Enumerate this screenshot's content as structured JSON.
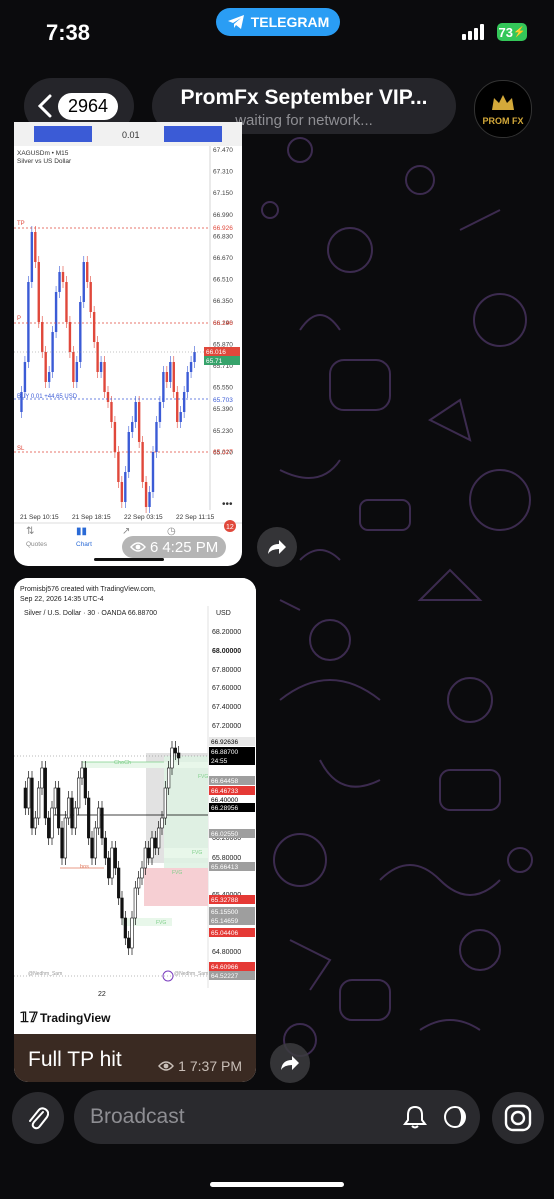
{
  "status_bar": {
    "time": "7:38",
    "telegram_label": "TELEGRAM",
    "battery": "73"
  },
  "header": {
    "back_count": "2964",
    "title": "PromFx September VIP...",
    "subtitle": "waiting for network...",
    "avatar_text": "PROM FX"
  },
  "message1": {
    "symbol": "XAGUSDm • M15",
    "description": "Silver vs US Dollar",
    "top_values": [
      "0.01"
    ],
    "price_ticks": [
      "67.470",
      "67.310",
      "67.150",
      "66.990",
      "66.830",
      "66.670",
      "66.510",
      "66.350",
      "66.190",
      "65.870",
      "65.710",
      "65.550",
      "65.390",
      "65.230",
      "65.070"
    ],
    "level_labels": {
      "tp": "TP",
      "tp_price": "66.926",
      "entry": "P",
      "entry_price": "66.246",
      "current_bid": "66.016",
      "current_ask": "65.71",
      "buy_line": "BUY 0.01 +44.65 USD",
      "buy_price": "65.703",
      "sl": "SL",
      "sl_price": "65.327"
    },
    "time_ticks": [
      "21 Sep 10:15",
      "21 Sep 18:15",
      "22 Sep 03:15",
      "22 Sep 11:15"
    ],
    "tabs": [
      "Quotes",
      "Chart",
      "Trade",
      "History",
      "Messages"
    ],
    "notification_badge": "12",
    "views": "6",
    "time": "4:25 PM"
  },
  "message2": {
    "header_line1": "Promisbj576 created with TradingView.com,",
    "header_line2": "Sep 22, 2026 14:35 UTC-4",
    "instrument": "Silver / U.S. Dollar · 30 · OANDA  66.88700",
    "currency": "USD",
    "price_ticks": [
      "68.20000",
      "68.00000",
      "67.80000",
      "67.60000",
      "67.40000",
      "67.20000",
      "66.20000",
      "65.80000",
      "65.40000",
      "65.00000",
      "64.80000"
    ],
    "tagged_prices": [
      {
        "value": "66.92636",
        "color": "#e8e8e8",
        "text": "#000"
      },
      {
        "value": "66.88700",
        "color": "#000000",
        "text": "#fff"
      },
      {
        "value": "24:55",
        "color": "#000000",
        "text": "#fff"
      },
      {
        "value": "66.64458",
        "color": "#9e9e9e",
        "text": "#fff"
      },
      {
        "value": "66.46733",
        "color": "#e53935",
        "text": "#fff"
      },
      {
        "value": "66.40000",
        "color": "#ffffff",
        "text": "#000"
      },
      {
        "value": "66.28956",
        "color": "#000000",
        "text": "#fff"
      },
      {
        "value": "66.02550",
        "color": "#9e9e9e",
        "text": "#fff"
      },
      {
        "value": "65.66413",
        "color": "#9e9e9e",
        "text": "#fff"
      },
      {
        "value": "65.32788",
        "color": "#e53935",
        "text": "#fff"
      },
      {
        "value": "65.15500",
        "color": "#9e9e9e",
        "text": "#fff"
      },
      {
        "value": "65.14659",
        "color": "#9e9e9e",
        "text": "#fff"
      },
      {
        "value": "65.04406",
        "color": "#e53935",
        "text": "#fff"
      },
      {
        "value": "64.60966",
        "color": "#e53935",
        "text": "#fff"
      },
      {
        "value": "64.52227",
        "color": "#9e9e9e",
        "text": "#fff"
      }
    ],
    "annotations": [
      "ChoCh",
      "bos",
      "FVG",
      "FVG",
      "FVG",
      "FVG",
      "@Nedhm_Sam"
    ],
    "x_label": "22",
    "brand": "TradingView",
    "caption": "Full TP hit",
    "views": "1",
    "time": "7:37 PM"
  },
  "composer": {
    "placeholder": "Broadcast"
  },
  "colors": {
    "accent": "#2a9df4",
    "bull": "#3b5bd6",
    "bear": "#e0483b",
    "caption_bg": "#3a2a22"
  }
}
